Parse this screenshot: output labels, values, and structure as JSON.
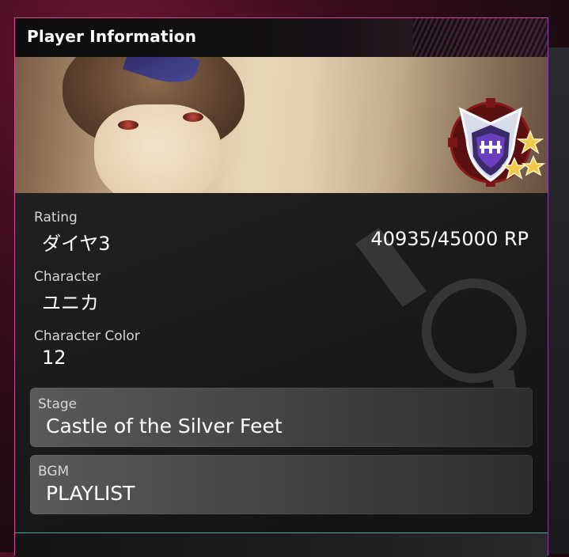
{
  "panel": {
    "title": "Player Information"
  },
  "rating": {
    "label": "Rating",
    "value": "ダイヤ3",
    "points": "40935/45000 RP"
  },
  "character": {
    "label": "Character",
    "value": "ユニカ"
  },
  "character_color": {
    "label": "Character Color",
    "value": "12"
  },
  "stage": {
    "label": "Stage",
    "value": "Castle of the Silver Feet"
  },
  "bgm": {
    "label": "BGM",
    "value": "PLAYLIST"
  },
  "colors": {
    "border_pink": "#d44a8a",
    "border_teal": "#2fa8a8",
    "badge_gold": "#f2c94c",
    "badge_purple": "#6a3fbf"
  },
  "icons": {
    "rank_badge": "diamond-rank-badge-icon",
    "emblem": "background-emblem-icon"
  }
}
